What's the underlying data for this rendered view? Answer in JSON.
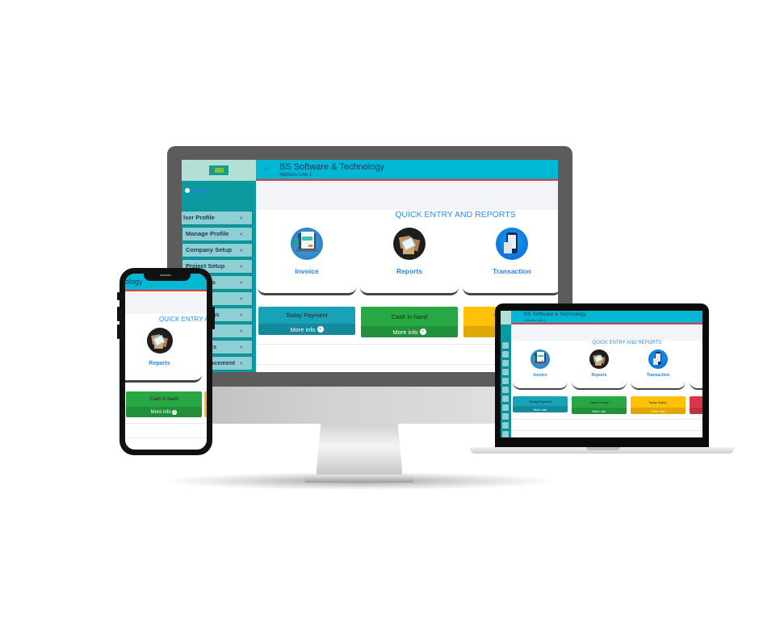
{
  "app": {
    "company_name": "BS Software & Technology",
    "address": "Address Line-1",
    "phone_title_fragment": "ology",
    "user_name": "junied",
    "menu_icon": "hamburger-icon",
    "logo": "company-logo"
  },
  "sidebar": {
    "items": [
      {
        "label": "User Profile",
        "visible_text": "lser Profile",
        "icon": "chevron-left-icon"
      },
      {
        "label": "Manage Profile",
        "icon": "chevron-left-icon"
      },
      {
        "label": "Company Setup",
        "icon": "chevron-left-icon"
      },
      {
        "label": "Project Setup",
        "icon": "chevron-left-icon"
      },
      {
        "label": "ues",
        "icon": "chevron-left-icon"
      },
      {
        "label": "ts",
        "icon": "chevron-left-icon"
      },
      {
        "label": "lings",
        "icon": "chevron-left-icon"
      },
      {
        "label": "",
        "icon": "chevron-left-icon"
      },
      {
        "label": "orts",
        "icon": "chevron-left-icon"
      },
      {
        "label": "placement",
        "icon": "chevron-left-icon"
      }
    ],
    "chevron_glyph": "‹"
  },
  "main": {
    "section_title": "QUICK ENTRY AND REPORTS",
    "quick_cards": [
      {
        "label": "Invoice",
        "icon": "invoice-icon"
      },
      {
        "label": "Reports",
        "icon": "reports-icon"
      },
      {
        "label": "Transaction",
        "icon": "transaction-icon"
      }
    ],
    "stat_boxes": [
      {
        "title": "Today Payment",
        "link": "More info",
        "color": "#17a2b8"
      },
      {
        "title": "Cash in hand",
        "link": "More info",
        "color": "#28a745"
      },
      {
        "title": "Today Sales :",
        "link": "More info",
        "color": "#ffc107"
      },
      {
        "title": "",
        "link": "",
        "color": "#dc3545"
      }
    ],
    "more_info_icon": "arrow-circle-right-icon",
    "more_info_glyph": "➔"
  },
  "colors": {
    "header": "#00b8d4",
    "sidebar": "#0a9aa0",
    "accent_line": "#e2363d",
    "title_blue": "#2a8ff0"
  }
}
